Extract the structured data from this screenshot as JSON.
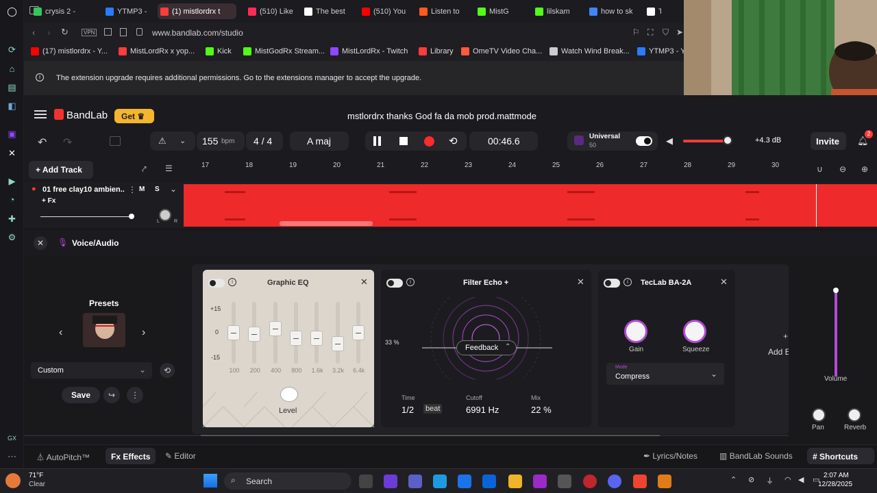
{
  "browser": {
    "tabs": [
      {
        "label": "crysis 2 -",
        "color": "#34c759"
      },
      {
        "label": "YTMP3 -",
        "color": "#2b7bff"
      },
      {
        "label": "(1) mistlordrx t",
        "color": "#ff3b3b",
        "active": true
      },
      {
        "label": "(510) Like",
        "color": "#ff2d55"
      },
      {
        "label": "The best",
        "color": "#ffffff"
      },
      {
        "label": "(510) You",
        "color": "#ff0000"
      },
      {
        "label": "Listen to",
        "color": "#ff5a1f"
      },
      {
        "label": "MistG",
        "color": "#53fc18"
      },
      {
        "label": "lilskam",
        "color": "#53fc18"
      },
      {
        "label": "how to sk",
        "color": "#4285f4"
      },
      {
        "label": "T",
        "color": "#ffffff"
      }
    ],
    "url": "www.bandlab.com/studio",
    "vpn_label": "VPN",
    "bookmarks": [
      {
        "label": "(17) mistlordrx - Y...",
        "color": "#ff0000"
      },
      {
        "label": "MistLordRx x yop...",
        "color": "#ff3b3b"
      },
      {
        "label": "Kick",
        "color": "#53fc18"
      },
      {
        "label": "MistGodRx Stream...",
        "color": "#53fc18"
      },
      {
        "label": "MistLordRx - Twitch",
        "color": "#9146ff"
      },
      {
        "label": "Library",
        "color": "#ff3b3b"
      },
      {
        "label": "OmeTV Video Cha...",
        "color": "#ff5a3c"
      },
      {
        "label": "Watch Wind Break...",
        "color": "#cccccc"
      },
      {
        "label": "YTMP3 - Y",
        "color": "#2b7bff"
      }
    ],
    "notice": "The extension upgrade requires additional permissions. Go to the extensions manager to accept the upgrade."
  },
  "bandlab": {
    "logo": "BandLab",
    "get_label": "Get",
    "project_title": "mstlordrx thanks God fa da mob prod.mattmode",
    "tempo": "155",
    "tempo_unit": "bpm",
    "time_sig_num": "4",
    "time_sig_sep": "/",
    "time_sig_den": "4",
    "key": "A maj",
    "time": "00:46.6",
    "universal_label": "Universal",
    "universal_count": "50",
    "volume_db": "+4.3 dB",
    "invite_label": "Invite",
    "notif_count": "2",
    "add_track_label": "Add Track",
    "ruler": [
      "17",
      "18",
      "19",
      "20",
      "21",
      "22",
      "23",
      "24",
      "25",
      "26",
      "27",
      "28",
      "29",
      "30"
    ],
    "track": {
      "name": "01  free clay10 ambien...",
      "mute": "M",
      "solo": "S",
      "fx_label": "+ Fx",
      "pan_l": "L",
      "pan_r": "R"
    },
    "panel_title": "Voice/Audio",
    "presets": {
      "title": "Presets",
      "selected": "Custom",
      "save_label": "Save"
    },
    "geq": {
      "title": "Graphic EQ",
      "scale": [
        "+15",
        "0",
        "-15"
      ],
      "bands": [
        "100",
        "200",
        "400",
        "800",
        "1.6k",
        "3.2k",
        "6.4k"
      ],
      "gains": [
        0.0,
        -0.05,
        0.15,
        -0.2,
        -0.2,
        -0.4,
        0.0
      ],
      "level_label": "Level"
    },
    "filter_echo": {
      "title": "Filter Echo +",
      "percent": "33 %",
      "mode": "Feedback",
      "time_label": "Time",
      "time_value": "1/2",
      "time_unit": "beat",
      "cutoff_label": "Cutoff",
      "cutoff_value": "6991 Hz",
      "mix_label": "Mix",
      "mix_value": "22 %"
    },
    "teclab": {
      "title": "TecLab BA-2A",
      "gain_label": "Gain",
      "squeeze_label": "Squeeze",
      "mode_label": "Mode",
      "mode_value": "Compress"
    },
    "add_effect_label": "Add E",
    "volume_label": "Volume",
    "pan_label": "Pan",
    "reverb_label": "Reverb",
    "footer": {
      "autopitch": "AutoPitch™",
      "effects": "Effects",
      "editor": "Editor",
      "lyrics": "Lyrics/Notes",
      "sounds": "BandLab Sounds",
      "shortcuts": "Shortcuts"
    }
  },
  "taskbar": {
    "weather_temp": "71°F",
    "weather_desc": "Clear",
    "search_label": "Search",
    "time": "2:07 AM",
    "date": "12/28/2025",
    "left_dock": "GX"
  }
}
